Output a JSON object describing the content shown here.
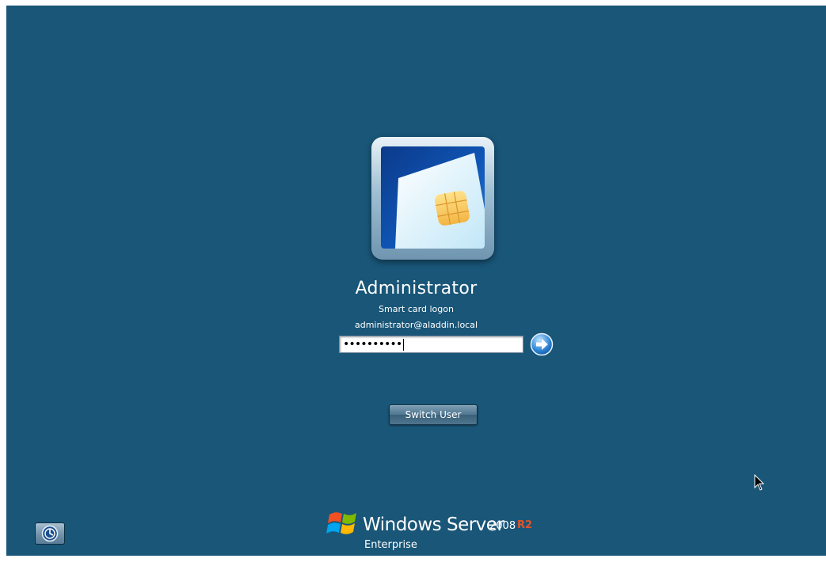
{
  "user": {
    "name": "Administrator",
    "logon_type": "Smart card logon",
    "account": "administrator@aladdin.local",
    "tile_icon": "smart-card-icon"
  },
  "password": {
    "masked_value": "••••••••••",
    "submit_icon": "arrow-right-icon"
  },
  "actions": {
    "switch_user_label": "Switch User",
    "ease_of_access_icon": "ease-of-access-icon"
  },
  "branding": {
    "product": "Windows Server",
    "version": "2008",
    "release": "R2",
    "edition": "Enterprise",
    "logo_icon": "windows-flag-icon"
  },
  "colors": {
    "background": "#195678",
    "release_accent": "#e0542b",
    "text": "#ffffff"
  }
}
